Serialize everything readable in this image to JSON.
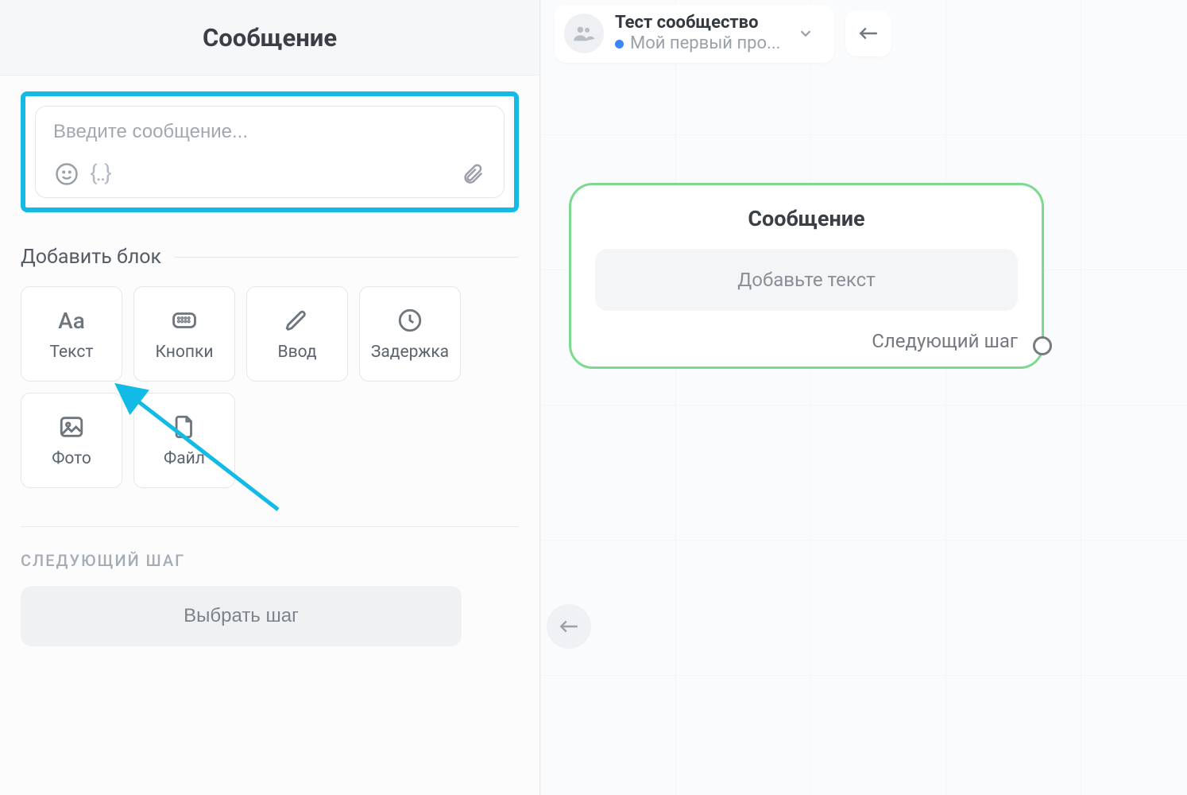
{
  "panel": {
    "title": "Сообщение",
    "message_placeholder": "Введите сообщение...",
    "add_block_label": "Добавить блок",
    "blocks": {
      "text": "Текст",
      "buttons": "Кнопки",
      "input": "Ввод",
      "delay": "Задержка",
      "photo": "Фото",
      "file": "Файл"
    },
    "next_step_heading": "СЛЕДУЮЩИЙ ШАГ",
    "choose_step": "Выбрать шаг",
    "tool_braces": "{..}"
  },
  "canvas": {
    "community": {
      "name": "Тест сообщество",
      "project": "Мой первый про..."
    },
    "node": {
      "title": "Сообщение",
      "placeholder": "Добавьте текст",
      "next_label": "Следующий шаг"
    }
  },
  "colors": {
    "highlight": "#12bbe6",
    "node_border": "#7cd98f",
    "status_dot": "#3b86f6"
  }
}
